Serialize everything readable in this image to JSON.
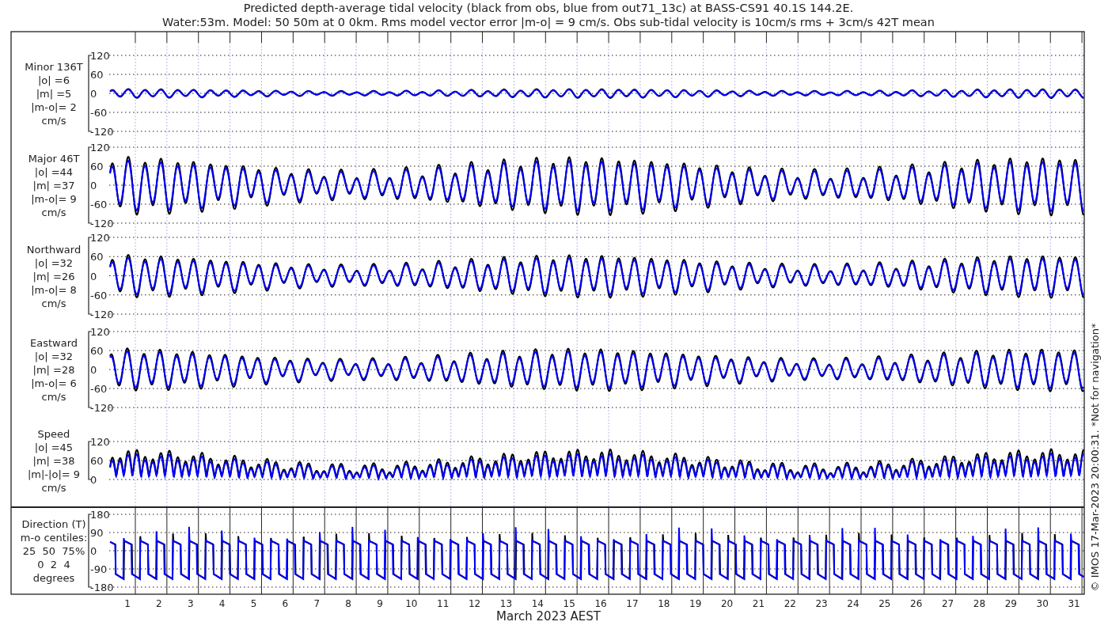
{
  "title": {
    "lines": [
      "Predicted depth-average tidal velocity (black from obs, blue from out71_13c) at BASS-CS91 40.1S 144.2E.",
      "Water:53m. Model: 50 50m at 0 0km. Rms model vector error |m-o| = 9 cm/s. Obs sub-tidal velocity is 10cm/s rms + 3cm/s 42T mean"
    ]
  },
  "panels": [
    {
      "kind": "minor",
      "label": [
        "Minor 136T",
        "|o| =6",
        "|m| =5",
        "|m-o|= 2",
        "cm/s"
      ],
      "yticks": [
        "120",
        "60",
        "0",
        "-60",
        "-120"
      ]
    },
    {
      "kind": "major",
      "label": [
        "Major 46T",
        "|o| =44",
        "|m| =37",
        "|m-o|= 9",
        "cm/s"
      ],
      "yticks": [
        "120",
        "60",
        "0",
        "-60",
        "-120"
      ]
    },
    {
      "kind": "north",
      "label": [
        "Northward",
        "|o| =32",
        "|m| =26",
        "|m-o|= 8",
        "cm/s"
      ],
      "yticks": [
        "120",
        "60",
        "0",
        "-60",
        "-120"
      ]
    },
    {
      "kind": "east",
      "label": [
        "Eastward",
        "|o| =32",
        "|m| =28",
        "|m-o|= 6",
        "cm/s"
      ],
      "yticks": [
        "120",
        "60",
        "0",
        "-60",
        "-120"
      ]
    },
    {
      "kind": "speed",
      "label": [
        "Speed",
        "|o| =45",
        "|m| =38",
        "|m|-|o|= 9",
        "cm/s"
      ],
      "yticks": [
        "120",
        "60",
        "0"
      ]
    },
    {
      "kind": "direction",
      "label": [
        "Direction (T)",
        "m-o centiles:",
        "25  50  75%",
        "0  2  4",
        "degrees"
      ],
      "yticks": [
        "180",
        "90",
        "0",
        "-90",
        "-180"
      ]
    }
  ],
  "x_axis": {
    "ticks": [
      "1",
      "2",
      "3",
      "4",
      "5",
      "6",
      "7",
      "8",
      "9",
      "10",
      "11",
      "12",
      "13",
      "14",
      "15",
      "16",
      "17",
      "18",
      "19",
      "20",
      "21",
      "22",
      "23",
      "24",
      "25",
      "26",
      "27",
      "28",
      "29",
      "30",
      "31"
    ],
    "label": "March 2023 AEST"
  },
  "credit": "© IMOS 17-Mar-2023 20:00:31. *Not for navigation*"
}
